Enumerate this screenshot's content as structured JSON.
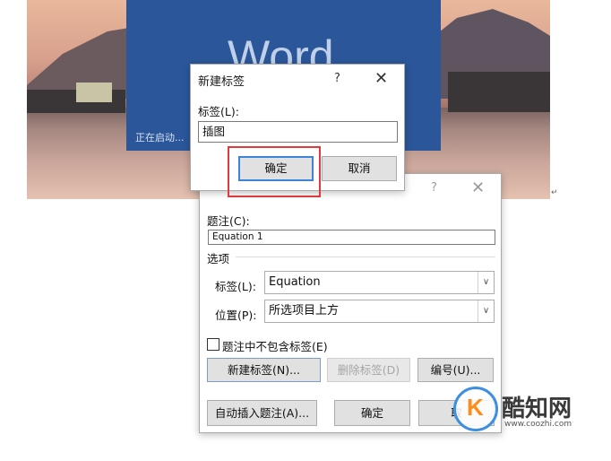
{
  "splash": {
    "app_name": "Word",
    "status": "正在启动..."
  },
  "new_label_dialog": {
    "title": "新建标签",
    "help": "?",
    "close": "✕",
    "label_caption": "标签(L):",
    "label_value": "插图",
    "ok": "确定",
    "cancel": "取消"
  },
  "caption_dialog": {
    "help": "?",
    "close": "✕",
    "caption_label": "题注(C):",
    "caption_value": "Equation 1",
    "options_label": "选项",
    "label_field_label": "标签(L):",
    "label_field_value": "Equation",
    "position_label": "位置(P):",
    "position_value": "所选项目上方",
    "exclude_label_checkbox": "题注中不包含标签(E)",
    "exclude_checked": false,
    "new_label_button": "新建标签(N)...",
    "delete_label_button": "删除标签(D)",
    "numbering_button": "编号(U)...",
    "autocaption_button": "自动插入题注(A)...",
    "ok_button": "确定",
    "cancel_button_partial": "取"
  },
  "watermark": {
    "brand": "酷知网",
    "url": "www.coozhi.com",
    "logo_letter": "K"
  },
  "colors": {
    "word_blue": "#2b579a",
    "highlight_red": "#e0393e",
    "primary_border": "#3b84d8"
  }
}
